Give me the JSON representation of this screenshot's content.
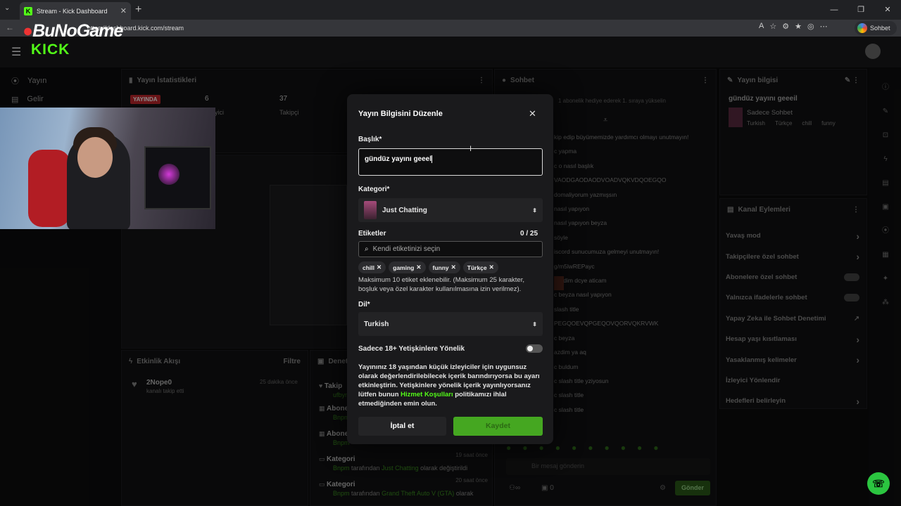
{
  "browser": {
    "tab_title": "Stream - Kick Dashboard",
    "url": "https://dashboard.kick.com/stream",
    "profile_label": "Sohbet et"
  },
  "watermark": {
    "brand": "BuNoGame"
  },
  "header": {
    "logo": "KICK"
  },
  "sidebar": {
    "items": [
      {
        "label": "Yayın",
        "icon": "broadcast-icon"
      },
      {
        "label": "Gelir",
        "icon": "revenue-icon"
      }
    ]
  },
  "stats": {
    "title": "Yayın İstatistikleri",
    "live_badge": "YAYINDA",
    "viewers_value": "6",
    "viewers_label": "İzleyici",
    "followers_value": "37",
    "followers_label": "Takipçi"
  },
  "activity": {
    "title": "Etkinlik Akışı",
    "filter_label": "Filtre",
    "item_name": "2Nope0",
    "item_text": "kanalı takip etti",
    "item_time": "25 dakika önce"
  },
  "events": {
    "title": "Denetim",
    "items": [
      {
        "title": "Takip",
        "desc": "ufbyn"
      },
      {
        "title": "Abone",
        "desc": "Bnpm"
      },
      {
        "title": "Abone",
        "desc": "Bnpm"
      },
      {
        "title": "Kategori",
        "desc_prefix": "Bnpm",
        "desc_mid": "tarafından",
        "desc_cat": "Just Chatting",
        "desc_suffix": "olarak değiştirildi",
        "time": "19 saat önce"
      },
      {
        "title": "Kategori",
        "desc_prefix": "Bnpm",
        "desc_mid": "tarafından",
        "desc_cat": "Grand Theft Auto V (GTA)",
        "desc_suffix": "olarak",
        "time": "20 saat önce"
      }
    ]
  },
  "chat": {
    "title": "Sohbet",
    "pinned": "1 abonelik hediye ederek 1. sıraya yükselin",
    "messages": [
      "kip edip büyümemizde yardımcı olmayı unutmayın!",
      "c yapma",
      "c o nasıl başlık",
      "VAODGAODAODVOADVQKVDQOEGQO",
      "domaliyorum yazmışsın",
      "nasıl yapıyon",
      "nasıl yapıyon beyza",
      "söyle",
      "iscord sunucumuza gelmeyi unutmayın!",
      "g/m5lwREPayc",
      "s aldim dcye aticam",
      "c beyza nasıl yapıyon",
      "slash title",
      "PEGQOEVQPGEQOVQORVQKRVWK",
      "c beyza",
      "azdim ya aq",
      "c buldum",
      "c slash title yziyosun",
      "c slash title",
      "c slash title"
    ],
    "input_placeholder": "Bir mesaj gönderin",
    "count": "0",
    "send_label": "Gönder"
  },
  "stream_info": {
    "title": "Yayın bilgisi",
    "stream_title": "gündüz yayını geeeil",
    "category": "Sadece Sohbet",
    "tags": [
      "Turkish",
      "Türkçe",
      "chill",
      "funny"
    ]
  },
  "channel_actions": {
    "title": "Kanal Eylemleri",
    "items": [
      {
        "label": "Yavaş mod",
        "control": "chevron"
      },
      {
        "label": "Takipçilere özel sohbet",
        "control": "chevron"
      },
      {
        "label": "Abonelere özel sohbet",
        "control": "toggle"
      },
      {
        "label": "Yalnızca ifadelerle sohbet",
        "control": "toggle"
      },
      {
        "label": "Yapay Zeka ile Sohbet Denetimi",
        "control": "external"
      },
      {
        "label": "Hesap yaşı kısıtlaması",
        "control": "chevron"
      },
      {
        "label": "Yasaklanmış kelimeler",
        "control": "chevron"
      },
      {
        "label": "İzleyici Yönlendir",
        "control": "none"
      },
      {
        "label": "Hedefleri belirleyin",
        "control": "chevron"
      }
    ]
  },
  "modal": {
    "title": "Yayın Bilgisini Düzenle",
    "title_label": "Başlık*",
    "title_value": "gündüz yayını geeel",
    "category_label": "Kategori*",
    "category_value": "Just Chatting",
    "tags_label": "Etiketler",
    "tags_count": "0 / 25",
    "tags_placeholder": "Kendi etiketinizi seçin",
    "tags": [
      "chill",
      "gaming",
      "funny",
      "Türkçe"
    ],
    "tags_help": "Maksimum 10 etiket eklenebilir. (Maksimum 25 karakter, boşluk veya özel karakter kullanılmasına izin verilmez).",
    "language_label": "Dil*",
    "language_value": "Turkish",
    "adult_label": "Sadece 18+ Yetişkinlere Yönelik",
    "adult_enabled": false,
    "adult_desc_1": "Yayınınız 18 yaşından küçük izleyiciler için uygunsuz olarak değerlendirilebilecek içerik barındırıyorsa bu ayarı etkinleştirin. Yetişkinlere yönelik içerik yayınlıyorsanız lütfen bunun",
    "adult_desc_link": "Hizmet Koşulları",
    "adult_desc_2": "politikamızı ihlal etmediğinden emin olun.",
    "cancel_label": "İptal et",
    "save_label": "Kaydet"
  },
  "colors": {
    "accent": "#53fc18",
    "save_button": "#45a721",
    "modal_bg": "#1a1a1c"
  }
}
